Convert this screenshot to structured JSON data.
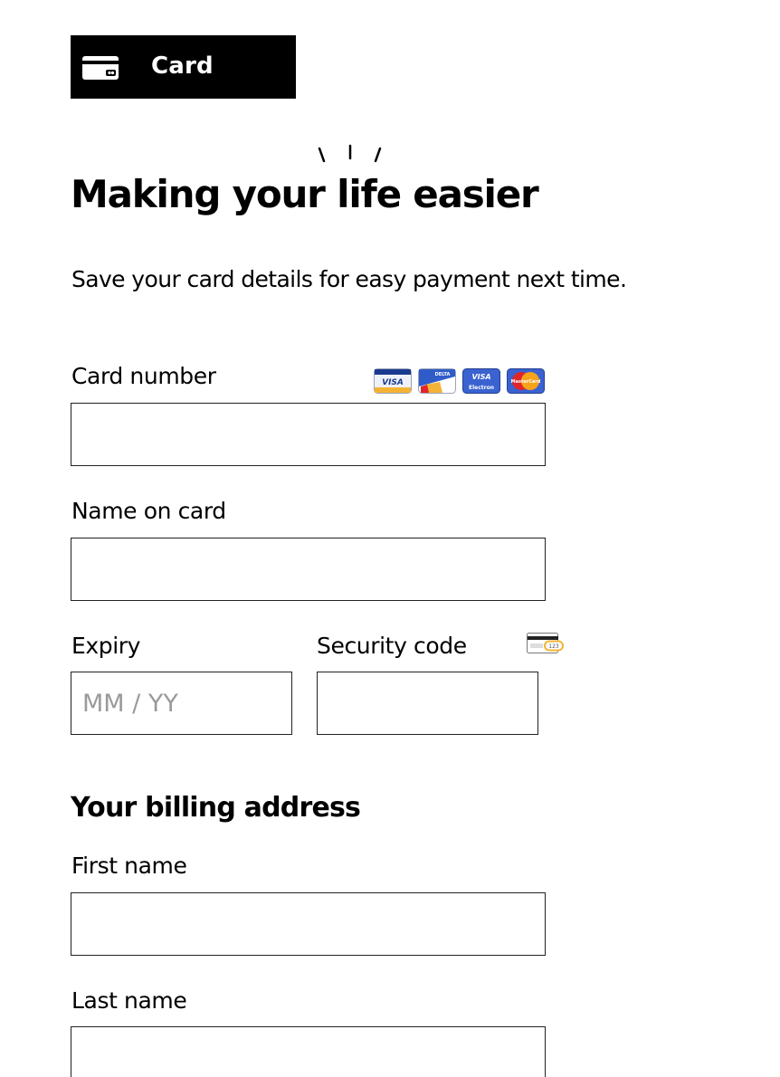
{
  "tab": {
    "label": "Card",
    "icon": "credit-card-icon"
  },
  "header": {
    "title": "Making your life easier",
    "subtitle": "Save your card details for easy payment next time."
  },
  "form": {
    "card_number": {
      "label": "Card number",
      "value": "",
      "placeholder": ""
    },
    "accepted_cards": [
      {
        "name": "VISA",
        "icon": "visa-card-icon"
      },
      {
        "name": "DELTA",
        "icon": "delta-card-icon"
      },
      {
        "name": "VISA Electron",
        "icon": "visa-electron-card-icon"
      },
      {
        "name": "MasterCard",
        "icon": "mastercard-card-icon"
      }
    ],
    "name_on_card": {
      "label": "Name on card",
      "value": "",
      "placeholder": ""
    },
    "expiry": {
      "label": "Expiry",
      "value": "",
      "placeholder": "MM / YY"
    },
    "security_code": {
      "label": "Security code",
      "value": "",
      "placeholder": "",
      "icon": "card-security-code-icon",
      "icon_text": "123"
    }
  },
  "billing": {
    "heading": "Your billing address",
    "first_name": {
      "label": "First name",
      "value": "",
      "placeholder": ""
    },
    "last_name": {
      "label": "Last name",
      "value": "",
      "placeholder": ""
    }
  },
  "colors": {
    "tab_background": "#000000",
    "tab_text": "#ffffff",
    "text": "#000000",
    "input_border": "#222222",
    "placeholder": "#9a9a9a",
    "visa_gold": "#f5b335",
    "visa_blue": "#1a3a8f",
    "mastercard_red": "#e0262b",
    "mastercard_orange": "#f7a21b"
  }
}
